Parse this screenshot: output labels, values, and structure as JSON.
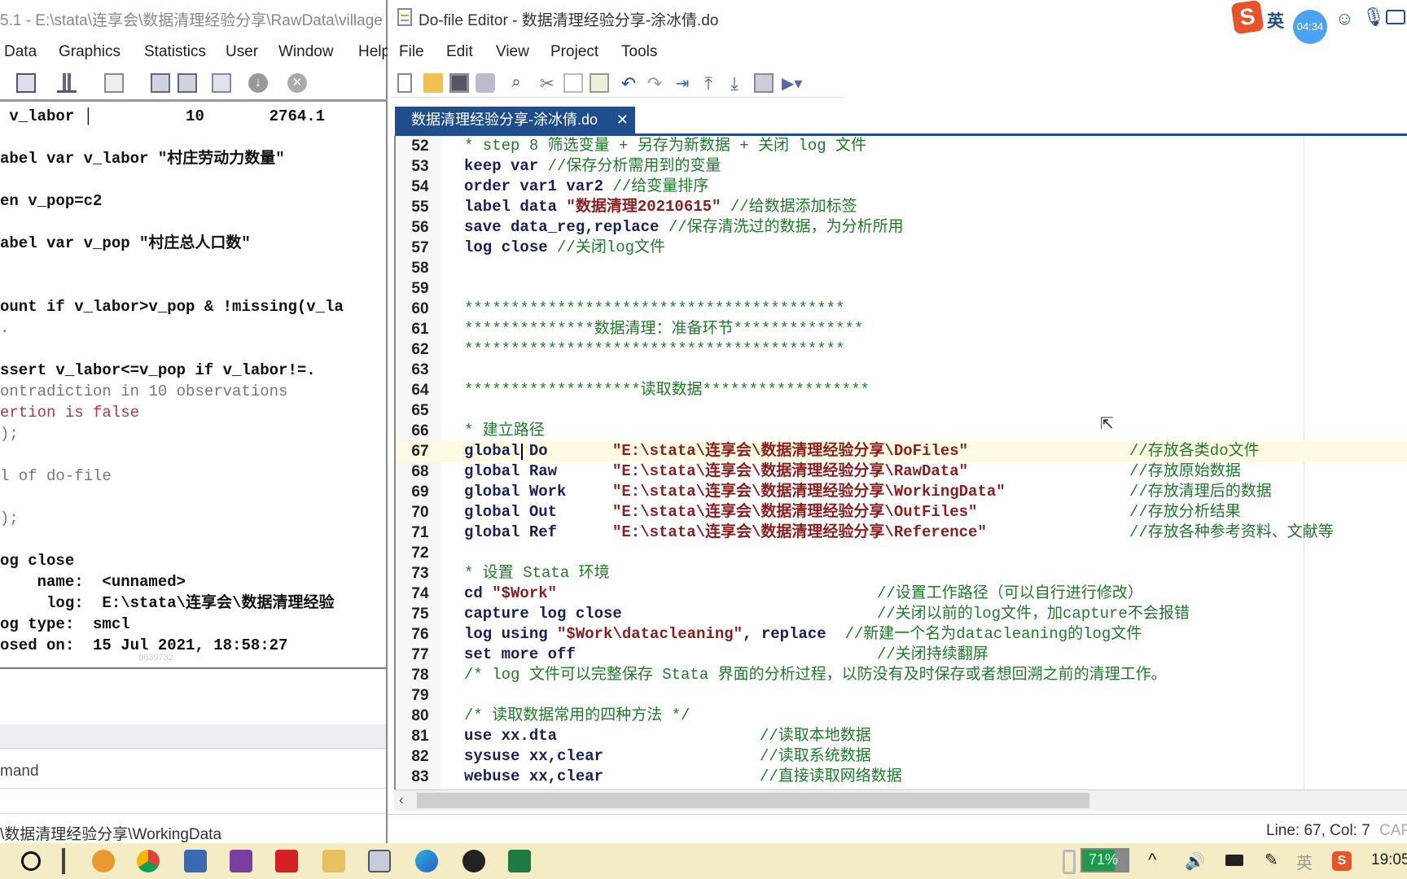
{
  "stata_window": {
    "title": "5.1 - E:\\stata\\连享会\\数据清理经验分享\\RawData\\village_",
    "menu": [
      "Data",
      "Graphics",
      "Statistics",
      "User",
      "Window",
      "Help"
    ],
    "results": [
      {
        "t": " v_labor │          10       2764.1",
        "s": "n"
      },
      {
        "t": "",
        "s": "n"
      },
      {
        "t": "abel var v_labor \"村庄劳动力数量\"",
        "s": "n"
      },
      {
        "t": "",
        "s": "n"
      },
      {
        "t": "en v_pop=c2",
        "s": "n"
      },
      {
        "t": "",
        "s": "n"
      },
      {
        "t": "abel var v_pop \"村庄总人口数\"",
        "s": "n"
      },
      {
        "t": "",
        "s": "n"
      },
      {
        "t": "",
        "s": "n"
      },
      {
        "t": "ount if v_labor>v_pop & !missing(v_la",
        "s": "n"
      },
      {
        "t": ".",
        "s": "f"
      },
      {
        "t": "",
        "s": "n"
      },
      {
        "t": "ssert v_labor<=v_pop if v_labor!=.",
        "s": "n"
      },
      {
        "t": "ontradiction in 10 observations",
        "s": "f"
      },
      {
        "t": "ertion is false",
        "s": "r"
      },
      {
        "t": ");",
        "s": "f"
      },
      {
        "t": "",
        "s": "n"
      },
      {
        "t": "l of do-file",
        "s": "f"
      },
      {
        "t": "",
        "s": "n"
      },
      {
        "t": ");",
        "s": "f"
      },
      {
        "t": "",
        "s": "n"
      },
      {
        "t": "og close",
        "s": "n"
      },
      {
        "t": "    name:  <unnamed>",
        "s": "n"
      },
      {
        "t": "     log:  E:\\stata\\连享会\\数据清理经验",
        "s": "n"
      },
      {
        "t": "og type:  smcl",
        "s": "n"
      },
      {
        "t": "osed on:  15 Jul 2021, 18:58:27",
        "s": "n"
      }
    ],
    "watermark": "9639732",
    "command_label": "mand",
    "status_path": "\\数据清理经验分享\\WorkingData"
  },
  "editor": {
    "title": "Do-file Editor - 数据清理经验分享-涂冰倩.do",
    "menu": [
      "File",
      "Edit",
      "View",
      "Project",
      "Tools"
    ],
    "tab": "数据清理经验分享-涂冰倩.do",
    "tab_close": "✕",
    "status": "Line: 67, Col: 7",
    "caps": "CAP",
    "current_line": 67,
    "lines": [
      {
        "n": 52,
        "seg": [
          [
            "cm",
            "* step 8 筛选变量 + 另存为新数据 + 关闭 log 文件"
          ]
        ]
      },
      {
        "n": 53,
        "seg": [
          [
            "kw",
            "keep var "
          ],
          [
            "cm",
            "//保存分析需用到的变量"
          ]
        ]
      },
      {
        "n": 54,
        "seg": [
          [
            "kw",
            "order var1 var2 "
          ],
          [
            "cm",
            "//给变量排序"
          ]
        ]
      },
      {
        "n": 55,
        "seg": [
          [
            "kw",
            "label data "
          ],
          [
            "str",
            "\"数据清理20210615\""
          ],
          [
            "cm",
            " //给数据添加标签"
          ]
        ]
      },
      {
        "n": 56,
        "seg": [
          [
            "kw",
            "save data_reg,replace "
          ],
          [
            "cm",
            "//保存清洗过的数据，为分析所用"
          ]
        ]
      },
      {
        "n": 57,
        "seg": [
          [
            "kw",
            "log close "
          ],
          [
            "cm",
            "//关闭log文件"
          ]
        ]
      },
      {
        "n": 58,
        "seg": []
      },
      {
        "n": 59,
        "seg": []
      },
      {
        "n": 60,
        "seg": [
          [
            "cm",
            "*****************************************"
          ]
        ]
      },
      {
        "n": 61,
        "seg": [
          [
            "cm",
            "**************数据清理：准备环节**************"
          ]
        ]
      },
      {
        "n": 62,
        "seg": [
          [
            "cm",
            "*****************************************"
          ]
        ]
      },
      {
        "n": 63,
        "seg": []
      },
      {
        "n": 64,
        "seg": [
          [
            "cm",
            "*******************读取数据******************"
          ]
        ]
      },
      {
        "n": 65,
        "seg": []
      },
      {
        "n": 66,
        "seg": [
          [
            "cm",
            "* 建立路径"
          ]
        ]
      },
      {
        "n": 67,
        "seg": [
          [
            "kw",
            "global Do"
          ],
          [
            "str",
            "\"E:\\stata\\连享会\\数据清理经验分享\\DoFiles\""
          ],
          [
            "cm",
            "//存放各类do文件"
          ]
        ]
      },
      {
        "n": 68,
        "seg": [
          [
            "kw",
            "global Raw"
          ],
          [
            "str",
            "\"E:\\stata\\连享会\\数据清理经验分享\\RawData\""
          ],
          [
            "cm",
            "//存放原始数据"
          ]
        ]
      },
      {
        "n": 69,
        "seg": [
          [
            "kw",
            "global Work"
          ],
          [
            "str",
            "\"E:\\stata\\连享会\\数据清理经验分享\\WorkingData\""
          ],
          [
            "cm",
            "//存放清理后的数据"
          ]
        ]
      },
      {
        "n": 70,
        "seg": [
          [
            "kw",
            "global Out"
          ],
          [
            "str",
            "\"E:\\stata\\连享会\\数据清理经验分享\\OutFiles\""
          ],
          [
            "cm",
            "//存放分析结果"
          ]
        ]
      },
      {
        "n": 71,
        "seg": [
          [
            "kw",
            "global Ref"
          ],
          [
            "str",
            "\"E:\\stata\\连享会\\数据清理经验分享\\Reference\""
          ],
          [
            "cm",
            "//存放各种参考资料、文献等"
          ]
        ]
      },
      {
        "n": 72,
        "seg": []
      },
      {
        "n": 73,
        "seg": [
          [
            "cm",
            "* 设置 Stata 环境"
          ]
        ]
      },
      {
        "n": 74,
        "seg": [
          [
            "kw",
            "cd "
          ],
          [
            "str",
            "\"$Work\""
          ],
          [
            "cm",
            "//设置工作路径（可以自行进行修改）"
          ]
        ]
      },
      {
        "n": 75,
        "seg": [
          [
            "kw",
            "capture log close"
          ],
          [
            "cm",
            "//关闭以前的log文件，加capture不会报错"
          ]
        ]
      },
      {
        "n": 76,
        "seg": [
          [
            "kw",
            "log using "
          ],
          [
            "str",
            "\"$Work\\datacleaning\""
          ],
          [
            "kw",
            ", replace"
          ],
          [
            "cm",
            "  //新建一个名为datacleaning的log文件"
          ]
        ]
      },
      {
        "n": 77,
        "seg": [
          [
            "kw",
            "set more off"
          ],
          [
            "cm",
            "//关闭持续翻屏"
          ]
        ]
      },
      {
        "n": 78,
        "seg": [
          [
            "cm",
            "/* log 文件可以完整保存 Stata 界面的分析过程，以防没有及时保存或者想回溯之前的清理工作。"
          ]
        ]
      },
      {
        "n": 79,
        "seg": []
      },
      {
        "n": 80,
        "seg": [
          [
            "cm",
            "/* 读取数据常用的四种方法 */"
          ]
        ]
      },
      {
        "n": 81,
        "seg": [
          [
            "kw",
            "use xx.dta"
          ],
          [
            "cm",
            "//读取本地数据"
          ]
        ]
      },
      {
        "n": 82,
        "seg": [
          [
            "kw",
            "sysuse xx,clear"
          ],
          [
            "cm",
            "//读取系统数据"
          ]
        ]
      },
      {
        "n": 83,
        "seg": [
          [
            "kw",
            "webuse xx,clear"
          ],
          [
            "cm",
            "//直接读取网络数据"
          ]
        ]
      }
    ]
  },
  "ime": {
    "lang": "英",
    "timer": "04:34"
  },
  "taskbar": {
    "battery": "71%",
    "battery_level": 71,
    "ime_lang": "英",
    "clock": "19:05"
  },
  "colors": {
    "keyword": "#1a1f5c",
    "string": "#8a1f1f",
    "comment": "#1f7a2a",
    "tab": "#1f4e8c",
    "taskbar": "#f3ecc4"
  }
}
